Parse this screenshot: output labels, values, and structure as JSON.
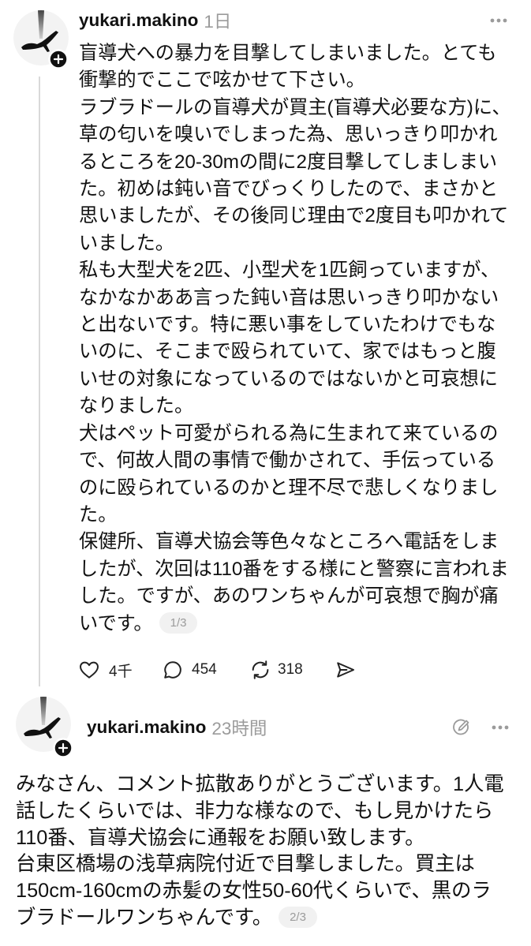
{
  "post_1": {
    "username": "yukari.makino",
    "time": "1日",
    "lines": [
      "盲導犬への暴力を目撃してしまいました。とても",
      "衝撃的でここで呟かせて下さい。",
      "ラブラドールの盲導犬が買主(盲導犬必要な方)に、",
      "草の匂いを嗅いでしまった為、思いっきり叩かれ",
      "るところを20-30mの間に2度目撃してしましまい",
      "た。初めは鈍い音でびっくりしたので、まさかと",
      "思いましたが、その後同じ理由で2度目も叩かれて",
      "いました。",
      "私も大型犬を2匹、小型犬を1匹飼っていますが、",
      "なかなかああ言った鈍い音は思いっきり叩かない",
      "と出ないです。特に悪い事をしていたわけでもな",
      "いのに、そこまで殴られていて、家ではもっと腹",
      "いせの対象になっているのではないかと可哀想に",
      "なりました。",
      "犬はペット可愛がられる為に生まれて来ているの",
      "で、何故人間の事情で働かされて、手伝っている",
      "のに殴られているのかと理不尽で悲しくなりまし",
      "た。",
      "保健所、盲導犬協会等色々なところへ電話をしま",
      "したが、次回は110番をする様にと警察に言われま",
      "した。ですが、あのワンちゃんが可哀想で胸が痛",
      "いです。"
    ],
    "page_badge": "1/3",
    "likes": "4千",
    "comments": "454",
    "reposts": "318"
  },
  "post_2": {
    "username": "yukari.makino",
    "time": "23時間",
    "lines": [
      "みなさん、コメント拡散ありがとうございます。1人電",
      "話したくらいでは、非力な様なので、もし見かけたら",
      "110番、盲導犬協会に通報をお願い致します。",
      "台東区橋場の浅草病院付近で目撃しました。買主は",
      "150cm-160cmの赤髪の女性50-60代くらいで、黒のラ",
      "ブラドールワンちゃんです。"
    ],
    "page_badge": "2/3"
  },
  "icons": {
    "avatar": "profile-avatar",
    "follow": "plus-icon",
    "more": "more-horizontal-icon",
    "edit": "edit-icon",
    "like": "heart-icon",
    "comment": "comment-bubble-icon",
    "repost": "repost-icon",
    "share": "send-icon"
  },
  "colors": {
    "background": "#ffffff",
    "text": "#111111",
    "muted": "#9b9b9b",
    "badge_background": "#f1f1f1",
    "thread_line": "#d9d9d9"
  }
}
